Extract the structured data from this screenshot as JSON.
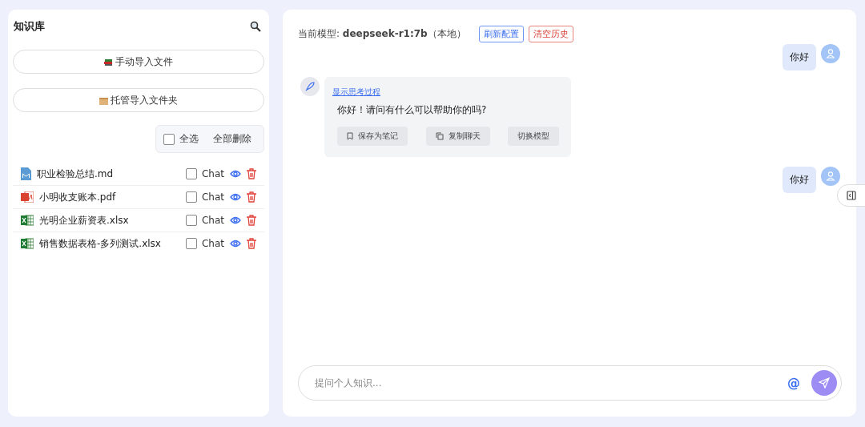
{
  "sidebar": {
    "title": "知识库",
    "import_buttons": [
      {
        "kind": "books",
        "label": "手动导入文件"
      },
      {
        "kind": "box",
        "label": "托管导入文件夹"
      }
    ],
    "select_all": {
      "label": "全选",
      "checked": false
    },
    "delete_all": "全部删除",
    "files": [
      {
        "kind": "md",
        "name": "职业检验总结.md",
        "checked": false,
        "chat_label": "Chat"
      },
      {
        "kind": "pdf",
        "name": "小明收支账本.pdf",
        "checked": false,
        "chat_label": "Chat"
      },
      {
        "kind": "xlsx",
        "name": "光明企业薪资表.xlsx",
        "checked": false,
        "chat_label": "Chat"
      },
      {
        "kind": "xlsx",
        "name": "销售数据表格-多列测试.xlsx",
        "checked": false,
        "chat_label": "Chat"
      }
    ]
  },
  "chat": {
    "model_prefix": "当前模型: ",
    "model_name": "deepseek-r1:7b",
    "model_suffix": "（本地）",
    "refresh_button": "刷新配置",
    "clear_button": "清空历史",
    "messages": [
      {
        "kind": "user",
        "text": "你好"
      },
      {
        "kind": "assistant",
        "link": "显示思考过程",
        "text": "你好！请问有什么可以帮助你的吗?",
        "actions": [
          {
            "kind": "bookmark",
            "label": "保存为笔记"
          },
          {
            "kind": "copy",
            "label": "复制聊天"
          },
          {
            "kind": "none",
            "label": "切换模型"
          }
        ]
      },
      {
        "kind": "user",
        "text": "你好"
      }
    ],
    "input": {
      "placeholder": "提问个人知识...",
      "mention": "@"
    }
  }
}
